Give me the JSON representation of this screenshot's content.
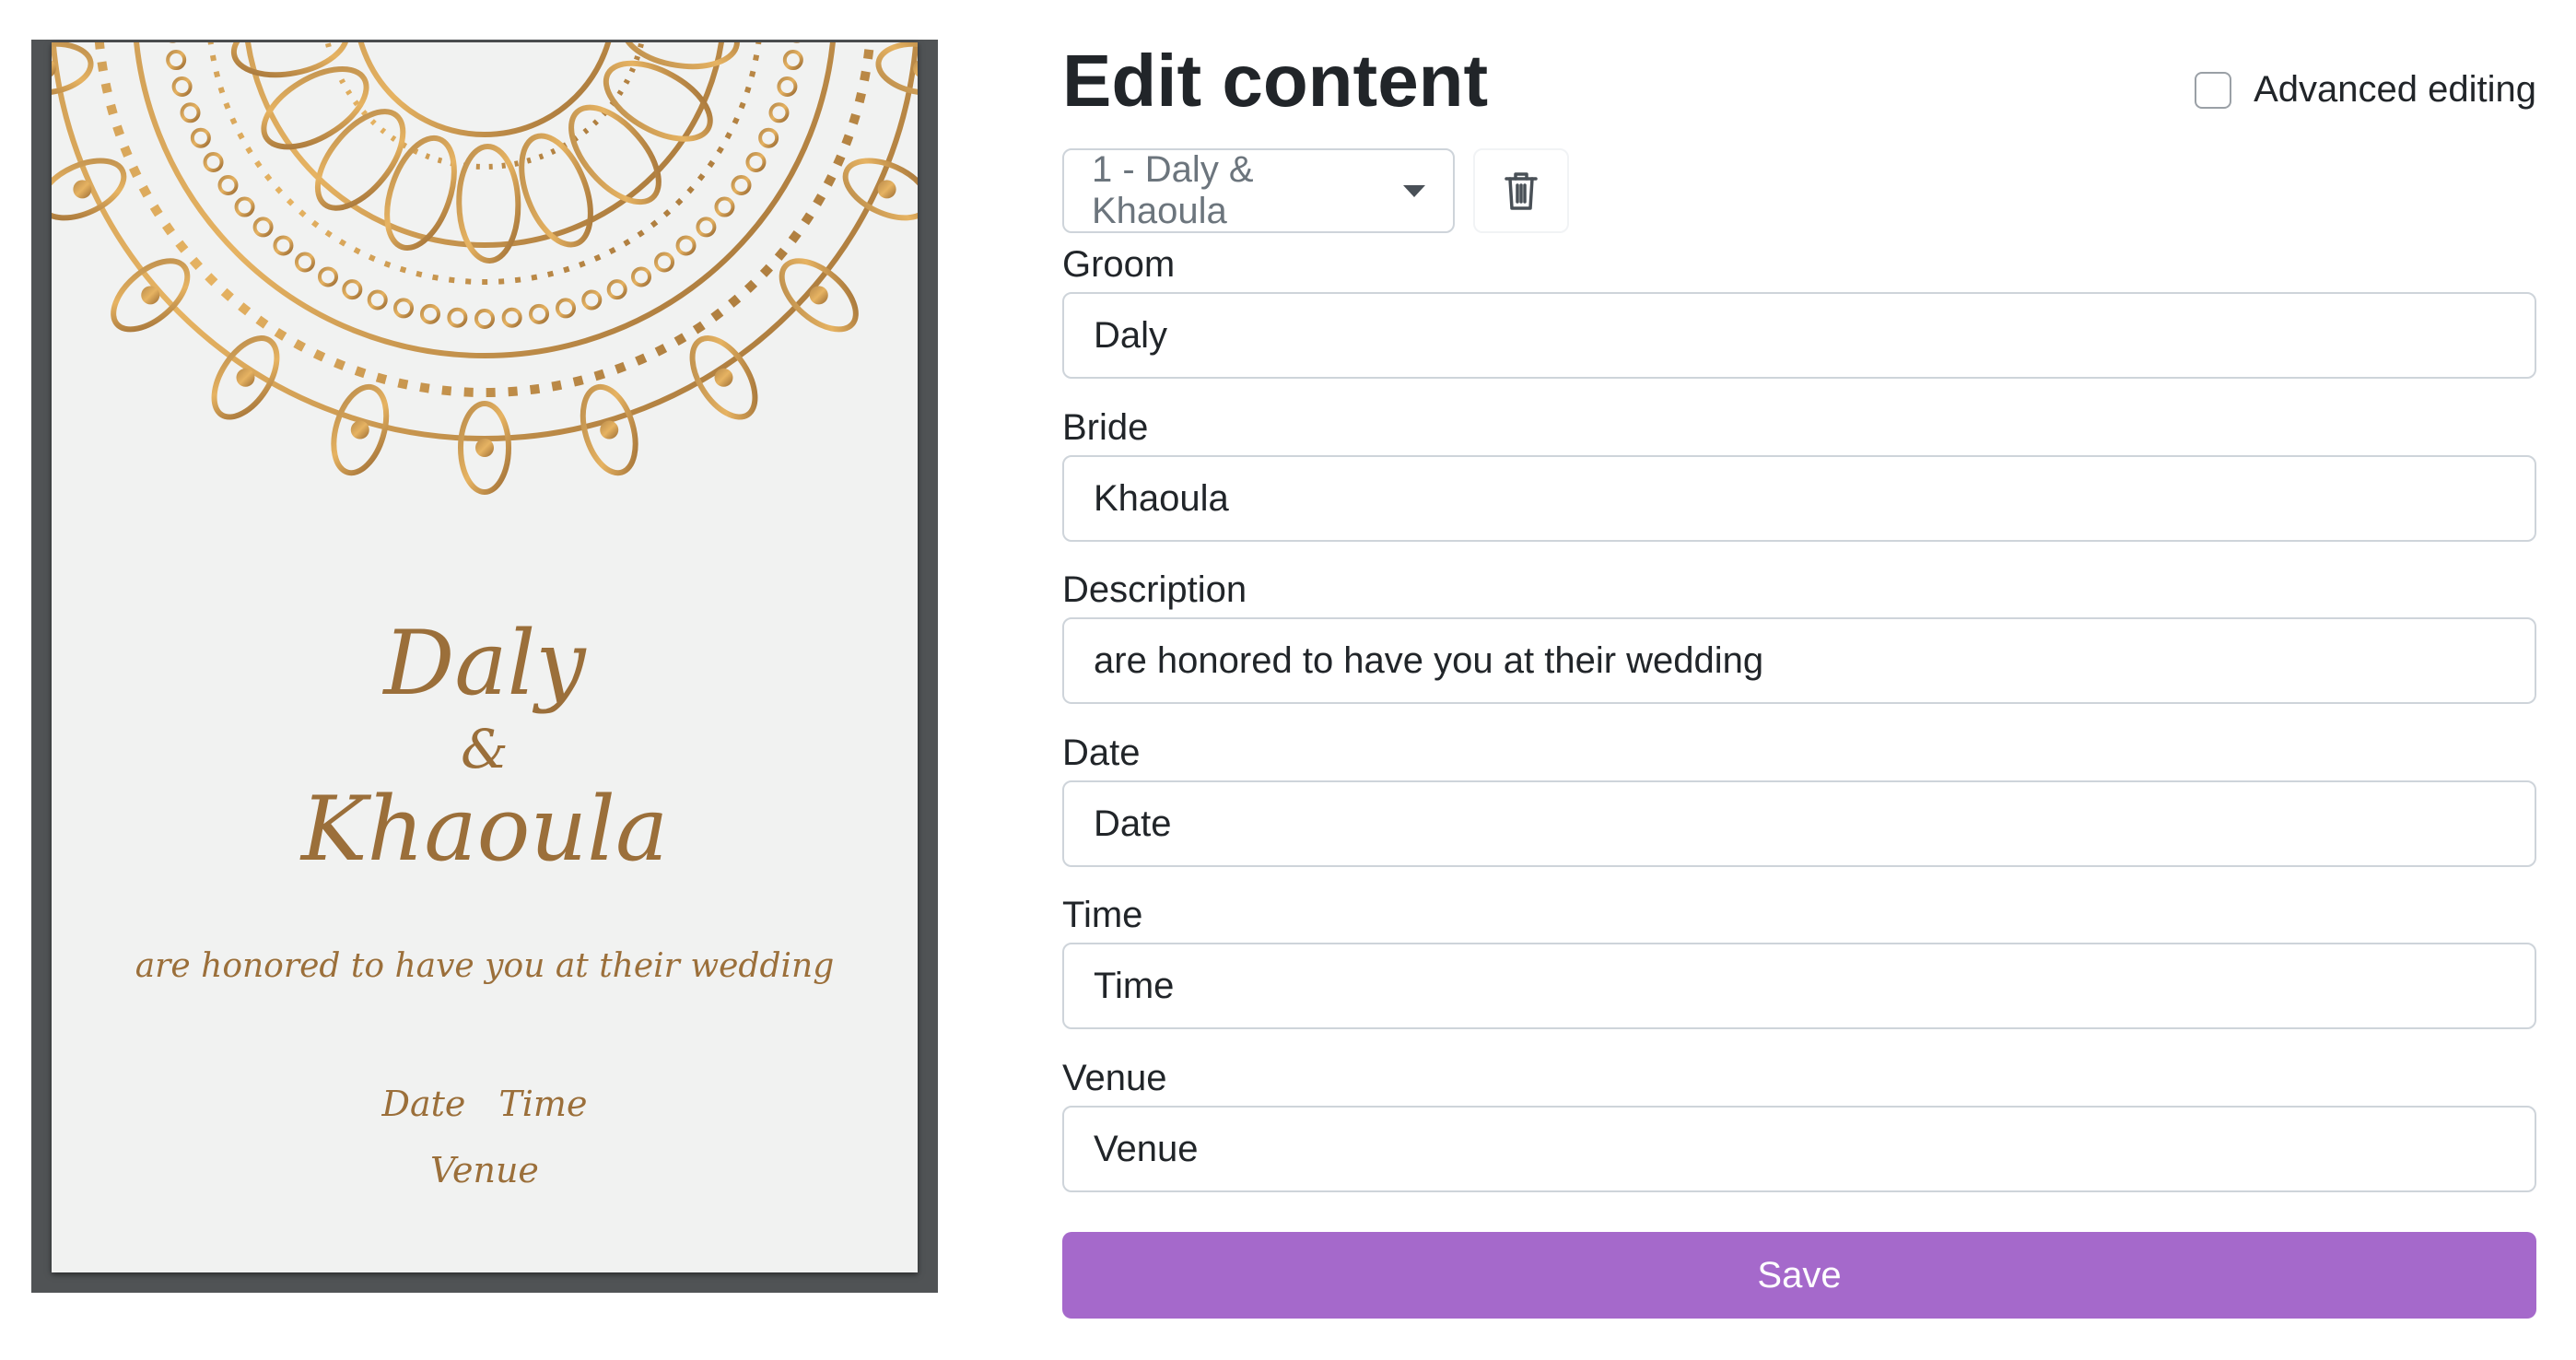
{
  "preview": {
    "groom": "Daly",
    "amp": "&",
    "bride": "Khaoula",
    "description": "are honored to have you at their wedding",
    "date": "Date",
    "time": "Time",
    "venue": "Venue",
    "accent_color": "#9b6f3a",
    "ornament_icon": "mandala-ornament"
  },
  "editor": {
    "title": "Edit content",
    "advanced_editing_label": "Advanced editing",
    "advanced_editing_checked": false,
    "version_select_value": "1 - Daly & Khaoula",
    "delete_icon": "trash-icon",
    "fields": [
      {
        "label": "Groom",
        "value": "Daly"
      },
      {
        "label": "Bride",
        "value": "Khaoula"
      },
      {
        "label": "Description",
        "value": "are honored to have you at their wedding"
      },
      {
        "label": "Date",
        "value": "Date"
      },
      {
        "label": "Time",
        "value": "Time"
      },
      {
        "label": "Venue",
        "value": "Venue"
      }
    ],
    "save_label": "Save",
    "save_color": "#a569cb"
  }
}
